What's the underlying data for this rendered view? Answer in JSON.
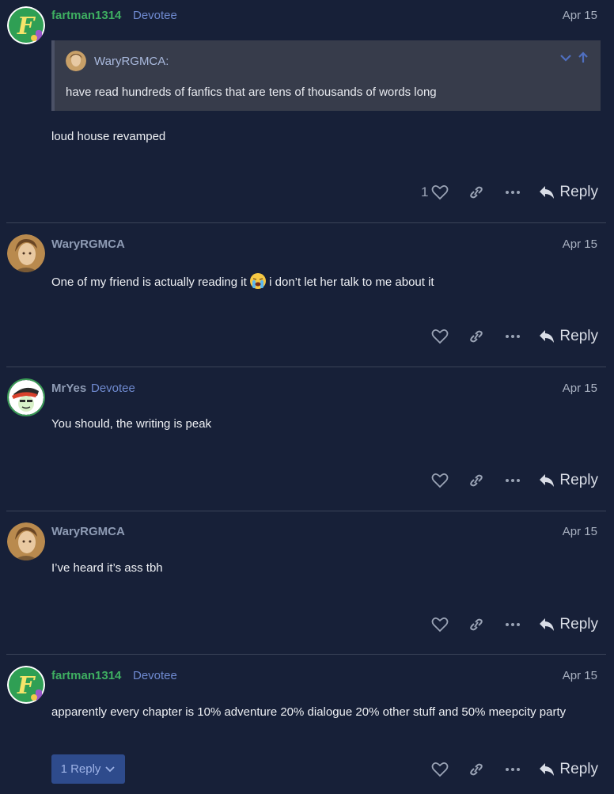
{
  "posts": [
    {
      "username": "fartman1314",
      "flair": "Devotee",
      "date": "Apr 15",
      "quote": {
        "author": "WaryRGMCA:",
        "text": "have read hundreds of fanfics that are tens of thousands of words long"
      },
      "text": "loud house revamped",
      "like_count": "1",
      "reply_label": "Reply"
    },
    {
      "username": "WaryRGMCA",
      "date": "Apr 15",
      "text_before_emoji": "One of my friend is actually reading it",
      "text_after_emoji": "i don’t let her talk to me about it",
      "reply_label": "Reply"
    },
    {
      "username": "MrYes",
      "flair": "Devotee",
      "date": "Apr 15",
      "text": "You should, the writing is peak",
      "reply_label": "Reply"
    },
    {
      "username": "WaryRGMCA",
      "date": "Apr 15",
      "text": "I’ve heard it’s ass tbh",
      "reply_label": "Reply"
    },
    {
      "username": "fartman1314",
      "flair": "Devotee",
      "date": "Apr 15",
      "text": "apparently every chapter is 10% adventure 20% dialogue 20% other stuff and 50% meepcity party",
      "replies_button": "1 Reply",
      "reply_label": "Reply"
    }
  ],
  "colors": {
    "background": "#172038",
    "username_green": "#3eae61",
    "username_gray": "#8e9bb4",
    "flair": "#6f8ad0",
    "quote_bg": "#373c4b",
    "replies_button_bg": "#2e4b8c"
  },
  "icons": [
    "heart-icon",
    "link-icon",
    "more-icon",
    "reply-arrow-icon",
    "chevron-down-icon",
    "arrow-up-icon",
    "loudly-crying-emoji"
  ]
}
